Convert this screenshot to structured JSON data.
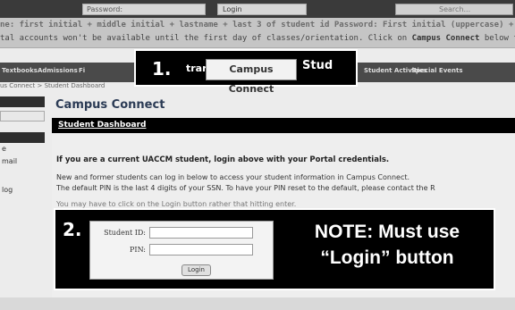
{
  "topbar": {
    "password_label": "Password:",
    "login_label": "Login",
    "search_placeholder": "Search..."
  },
  "info": {
    "line1": "ne: first initial + middle initial + lastname + last 3 of student id Password: First initial (uppercase) + entire St",
    "line2_pre": "tal accounts won't be available until the first day of classes/orientation.  Click on ",
    "line2_bold": "Campus Connect",
    "line2_post": " below to view yo"
  },
  "tabs": [
    "Textbooks",
    "Admissions",
    "Fi",
    "Student Activities",
    "Special Events"
  ],
  "breadcrumb": "us Connect > Student Dashboard",
  "callout1": {
    "number": "1.",
    "frag_left": "trar",
    "campus_connect": "Campus Connect",
    "frag_right": "Stud"
  },
  "leftnav": [
    "e",
    "mail",
    "log"
  ],
  "panel": {
    "title": "Campus Connect",
    "dashboard_link": "Student Dashboard",
    "bold_message": "If you are a current UACCM student, login above with your Portal credentials.",
    "para1": "New and former students can log in below to access your student information in Campus Connect.",
    "para2": "The default PIN is the last 4 digits of your SSN. To have your PIN reset to the default, please contact the R",
    "para3": "You may have to click on the Login button rather that hitting enter."
  },
  "callout2": {
    "number": "2.",
    "student_id_label": "Student ID:",
    "pin_label": "PIN:",
    "login_button": "Login",
    "note_line1": "NOTE: Must use",
    "note_line2": "“Login” button"
  }
}
